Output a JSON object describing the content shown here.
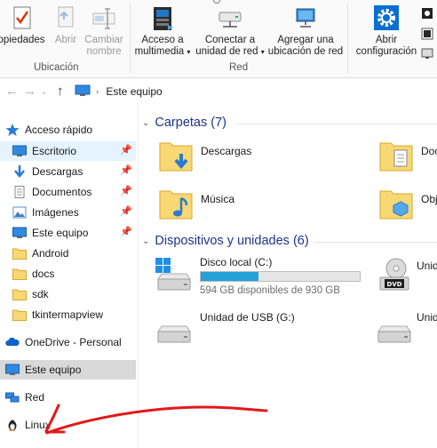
{
  "ribbon": {
    "location_group": {
      "label": "Ubicación",
      "buttons": [
        {
          "label": "opiedades",
          "icon": "properties-icon"
        },
        {
          "label": "Abrir",
          "icon": "open-icon",
          "disabled": true
        },
        {
          "label": "Cambiar\nnombre",
          "label1": "Cambiar",
          "label2": "nombre",
          "icon": "rename-icon",
          "disabled": true
        }
      ]
    },
    "network_group": {
      "label": "Red",
      "buttons": [
        {
          "label1": "Acceso a",
          "label2": "multimedia",
          "icon": "media-access-icon"
        },
        {
          "label1": "Conectar a",
          "label2": "unidad de red",
          "icon": "map-network-drive-icon"
        },
        {
          "label1": "Agregar una",
          "label2": "ubicación de red",
          "icon": "add-network-location-icon"
        }
      ]
    },
    "system_group": {
      "buttons": [
        {
          "label1": "Abrir",
          "label2": "configuración",
          "icon": "settings-icon"
        }
      ]
    }
  },
  "address_bar": {
    "path": "Este equipo"
  },
  "nav_pane": {
    "quick_access": "Acceso rápido",
    "pinned": [
      {
        "label": "Escritorio",
        "icon": "desktop-icon",
        "pinned": true
      },
      {
        "label": "Descargas",
        "icon": "downloads-icon",
        "pinned": true
      },
      {
        "label": "Documentos",
        "icon": "documents-icon",
        "pinned": true
      },
      {
        "label": "Imágenes",
        "icon": "pictures-icon",
        "pinned": true
      },
      {
        "label": "Este equipo",
        "icon": "this-pc-icon",
        "pinned": true
      },
      {
        "label": "Android",
        "icon": "folder-icon"
      },
      {
        "label": "docs",
        "icon": "folder-icon"
      },
      {
        "label": "sdk",
        "icon": "folder-icon"
      },
      {
        "label": "tkintermapview",
        "icon": "folder-icon"
      }
    ],
    "onedrive": "OneDrive - Personal",
    "this_pc": "Este equipo",
    "network": "Red",
    "linux": "Linux"
  },
  "content": {
    "folders_section": "Carpetas (7)",
    "folders": [
      {
        "label": "Descargas",
        "icon": "downloads-folder-icon"
      },
      {
        "label": "Docu",
        "icon": "documents-folder-icon"
      },
      {
        "label": "Música",
        "icon": "music-folder-icon"
      },
      {
        "label": "Obje",
        "icon": "3d-objects-folder-icon"
      }
    ],
    "devices_section": "Dispositivos y unidades (6)",
    "devices": [
      {
        "label": "Disco local (C:)",
        "free_text": "594 GB disponibles de 930 GB",
        "used_fraction": 0.361,
        "icon": "windows-drive-icon"
      },
      {
        "label": "Unid",
        "icon": "dvd-drive-icon"
      },
      {
        "label": "Unidad de USB (G:)",
        "icon": "usb-drive-icon"
      },
      {
        "label": "Unid",
        "icon": "drive-icon"
      }
    ]
  },
  "colors": {
    "accent": "#0078d7",
    "section_title": "#1e3287",
    "drive_fill": "#26a0da",
    "selected_nav": "#cce8ff",
    "annotation": "#e0191b"
  }
}
